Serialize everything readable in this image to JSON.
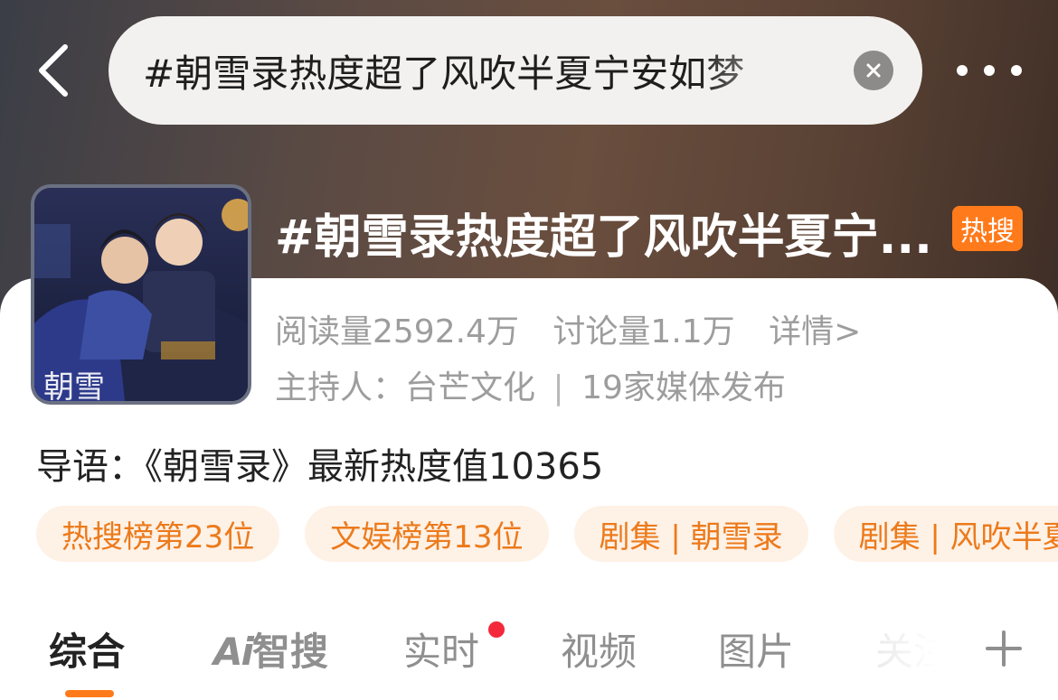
{
  "header": {
    "search_query": "#朝雪录热度超了风吹半夏宁安如梦",
    "clear_icon": "close-circle-icon",
    "back_icon": "chevron-left-icon",
    "more_icon": "more-dots-icon"
  },
  "topic": {
    "title": "#朝雪录热度超了风吹半夏宁...",
    "badge": "热搜",
    "read_count": "阅读量2592.4万",
    "discussion_count": "讨论量1.1万",
    "details_link": "详情>",
    "host_label": "主持人：台芒文化",
    "host_sep": "|",
    "media_count": "19家媒体发布"
  },
  "intro": {
    "text": "导语：《朝雪录》最新热度值10365"
  },
  "tags": [
    {
      "label": "热搜榜第23位"
    },
    {
      "label": "文娱榜第13位"
    },
    {
      "label": "剧集 | 朝雪录"
    },
    {
      "label": "剧集 | 风吹半夏"
    }
  ],
  "tabs": {
    "comprehensive": "综合",
    "ai_logo": "Ai",
    "ai_search": "智搜",
    "realtime": "实时",
    "video": "视频",
    "images": "图片",
    "follow": "关注"
  },
  "colors": {
    "accent": "#ff7a1a",
    "tag_bg": "#fef1e6",
    "tag_text": "#ec7a1b",
    "notification_dot": "#f4283b"
  }
}
